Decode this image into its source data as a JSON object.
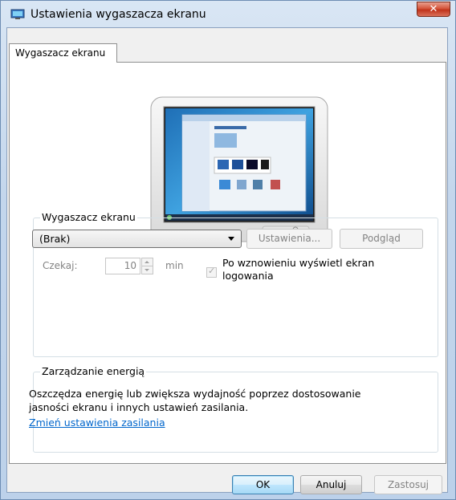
{
  "window": {
    "title": "Ustawienia wygaszacza ekranu",
    "close_glyph": "✕",
    "icon": "screensaver-monitor-icon"
  },
  "tabs": [
    {
      "label": "Wygaszacz ekranu",
      "selected": true
    }
  ],
  "screensaver": {
    "group_title": "Wygaszacz ekranu",
    "selected": "(Brak)",
    "settings_button": "Ustawienia...",
    "preview_button": "Podgląd",
    "wait_label": "Czekaj:",
    "wait_value": "10",
    "wait_unit": "min",
    "resume_label_1": "Po wznowieniu wyświetl ekran",
    "resume_label_2": "logowania",
    "resume_checked": true
  },
  "power": {
    "group_title": "Zarządzanie energią",
    "description_1": "Oszczędza energię lub zwiększa wydajność poprzez dostosowanie",
    "description_2": "jasności ekranu i innych ustawień zasilania.",
    "link": "Zmień ustawienia zasilania"
  },
  "footer": {
    "ok": "OK",
    "cancel": "Anuluj",
    "apply": "Zastosuj"
  },
  "colors": {
    "link": "#0066cc",
    "accent": "#3c7fb1"
  }
}
